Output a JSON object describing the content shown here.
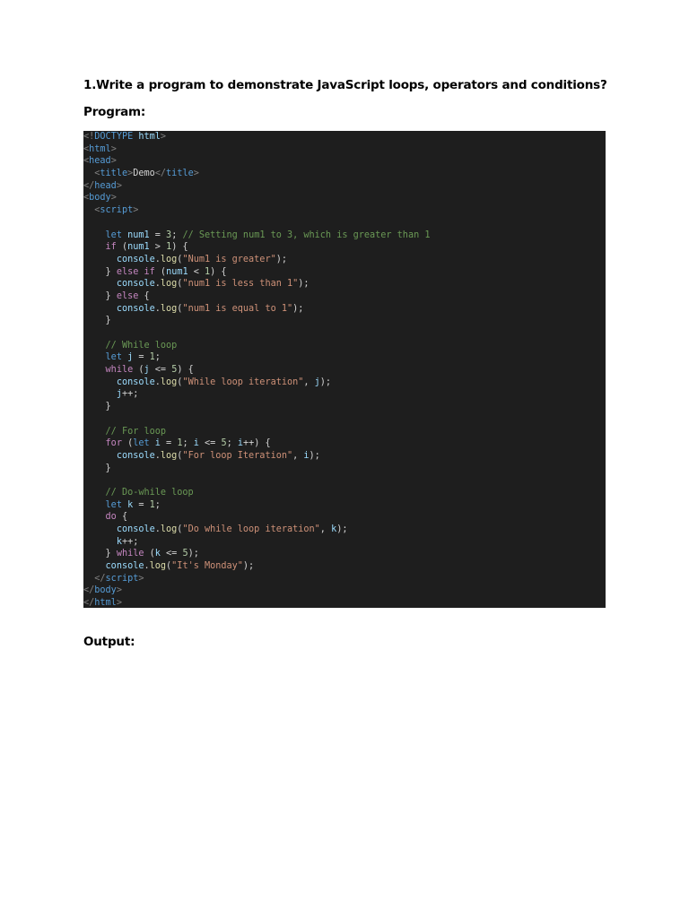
{
  "document": {
    "question": "1.Write a program to demonstrate JavaScript loops, operators and conditions?",
    "program_label": "Program:",
    "output_label": "Output:"
  },
  "code_block": {
    "background_color": "#1e1e1e",
    "lines": [
      [
        {
          "t": "<!",
          "c": "punct"
        },
        {
          "t": "DOCTYPE",
          "c": "tag"
        },
        {
          "t": " ",
          "c": "plain"
        },
        {
          "t": "html",
          "c": "var"
        },
        {
          "t": ">",
          "c": "punct"
        }
      ],
      [
        {
          "t": "<",
          "c": "punct"
        },
        {
          "t": "html",
          "c": "tag"
        },
        {
          "t": ">",
          "c": "punct"
        }
      ],
      [
        {
          "t": "<",
          "c": "punct"
        },
        {
          "t": "head",
          "c": "tag"
        },
        {
          "t": ">",
          "c": "punct"
        }
      ],
      [
        {
          "t": "  <",
          "c": "punct"
        },
        {
          "t": "title",
          "c": "tag"
        },
        {
          "t": ">",
          "c": "punct"
        },
        {
          "t": "Demo",
          "c": "plain"
        },
        {
          "t": "</",
          "c": "punct"
        },
        {
          "t": "title",
          "c": "tag"
        },
        {
          "t": ">",
          "c": "punct"
        }
      ],
      [
        {
          "t": "</",
          "c": "punct"
        },
        {
          "t": "head",
          "c": "tag"
        },
        {
          "t": ">",
          "c": "punct"
        }
      ],
      [
        {
          "t": "<",
          "c": "punct"
        },
        {
          "t": "body",
          "c": "tag"
        },
        {
          "t": ">",
          "c": "punct"
        }
      ],
      [
        {
          "t": "  <",
          "c": "punct"
        },
        {
          "t": "script",
          "c": "tag"
        },
        {
          "t": ">",
          "c": "punct"
        }
      ],
      [],
      [
        {
          "t": "    ",
          "c": "plain"
        },
        {
          "t": "let",
          "c": "kw"
        },
        {
          "t": " ",
          "c": "plain"
        },
        {
          "t": "num1",
          "c": "var"
        },
        {
          "t": " = ",
          "c": "plain"
        },
        {
          "t": "3",
          "c": "num"
        },
        {
          "t": "; ",
          "c": "plain"
        },
        {
          "t": "// Setting num1 to 3, which is greater than 1",
          "c": "cmt"
        }
      ],
      [
        {
          "t": "    ",
          "c": "plain"
        },
        {
          "t": "if",
          "c": "ctrl"
        },
        {
          "t": " (",
          "c": "plain"
        },
        {
          "t": "num1",
          "c": "var"
        },
        {
          "t": " > ",
          "c": "plain"
        },
        {
          "t": "1",
          "c": "num"
        },
        {
          "t": ") {",
          "c": "plain"
        }
      ],
      [
        {
          "t": "      ",
          "c": "plain"
        },
        {
          "t": "console",
          "c": "var"
        },
        {
          "t": ".",
          "c": "plain"
        },
        {
          "t": "log",
          "c": "fn"
        },
        {
          "t": "(",
          "c": "plain"
        },
        {
          "t": "\"Num1 is greater\"",
          "c": "str"
        },
        {
          "t": ");",
          "c": "plain"
        }
      ],
      [
        {
          "t": "    } ",
          "c": "plain"
        },
        {
          "t": "else",
          "c": "ctrl"
        },
        {
          "t": " ",
          "c": "plain"
        },
        {
          "t": "if",
          "c": "ctrl"
        },
        {
          "t": " (",
          "c": "plain"
        },
        {
          "t": "num1",
          "c": "var"
        },
        {
          "t": " < ",
          "c": "plain"
        },
        {
          "t": "1",
          "c": "num"
        },
        {
          "t": ") {",
          "c": "plain"
        }
      ],
      [
        {
          "t": "      ",
          "c": "plain"
        },
        {
          "t": "console",
          "c": "var"
        },
        {
          "t": ".",
          "c": "plain"
        },
        {
          "t": "log",
          "c": "fn"
        },
        {
          "t": "(",
          "c": "plain"
        },
        {
          "t": "\"num1 is less than 1\"",
          "c": "str"
        },
        {
          "t": ");",
          "c": "plain"
        }
      ],
      [
        {
          "t": "    } ",
          "c": "plain"
        },
        {
          "t": "else",
          "c": "ctrl"
        },
        {
          "t": " {",
          "c": "plain"
        }
      ],
      [
        {
          "t": "      ",
          "c": "plain"
        },
        {
          "t": "console",
          "c": "var"
        },
        {
          "t": ".",
          "c": "plain"
        },
        {
          "t": "log",
          "c": "fn"
        },
        {
          "t": "(",
          "c": "plain"
        },
        {
          "t": "\"num1 is equal to 1\"",
          "c": "str"
        },
        {
          "t": ");",
          "c": "plain"
        }
      ],
      [
        {
          "t": "    }",
          "c": "plain"
        }
      ],
      [],
      [
        {
          "t": "    ",
          "c": "plain"
        },
        {
          "t": "// While loop",
          "c": "cmt"
        }
      ],
      [
        {
          "t": "    ",
          "c": "plain"
        },
        {
          "t": "let",
          "c": "kw"
        },
        {
          "t": " ",
          "c": "plain"
        },
        {
          "t": "j",
          "c": "var"
        },
        {
          "t": " = ",
          "c": "plain"
        },
        {
          "t": "1",
          "c": "num"
        },
        {
          "t": ";",
          "c": "plain"
        }
      ],
      [
        {
          "t": "    ",
          "c": "plain"
        },
        {
          "t": "while",
          "c": "ctrl"
        },
        {
          "t": " (",
          "c": "plain"
        },
        {
          "t": "j",
          "c": "var"
        },
        {
          "t": " <= ",
          "c": "plain"
        },
        {
          "t": "5",
          "c": "num"
        },
        {
          "t": ") {",
          "c": "plain"
        }
      ],
      [
        {
          "t": "      ",
          "c": "plain"
        },
        {
          "t": "console",
          "c": "var"
        },
        {
          "t": ".",
          "c": "plain"
        },
        {
          "t": "log",
          "c": "fn"
        },
        {
          "t": "(",
          "c": "plain"
        },
        {
          "t": "\"While loop iteration\"",
          "c": "str"
        },
        {
          "t": ", ",
          "c": "plain"
        },
        {
          "t": "j",
          "c": "var"
        },
        {
          "t": ");",
          "c": "plain"
        }
      ],
      [
        {
          "t": "      ",
          "c": "plain"
        },
        {
          "t": "j",
          "c": "var"
        },
        {
          "t": "++;",
          "c": "plain"
        }
      ],
      [
        {
          "t": "    }",
          "c": "plain"
        }
      ],
      [],
      [
        {
          "t": "    ",
          "c": "plain"
        },
        {
          "t": "// For loop",
          "c": "cmt"
        }
      ],
      [
        {
          "t": "    ",
          "c": "plain"
        },
        {
          "t": "for",
          "c": "ctrl"
        },
        {
          "t": " (",
          "c": "plain"
        },
        {
          "t": "let",
          "c": "kw"
        },
        {
          "t": " ",
          "c": "plain"
        },
        {
          "t": "i",
          "c": "var"
        },
        {
          "t": " = ",
          "c": "plain"
        },
        {
          "t": "1",
          "c": "num"
        },
        {
          "t": "; ",
          "c": "plain"
        },
        {
          "t": "i",
          "c": "var"
        },
        {
          "t": " <= ",
          "c": "plain"
        },
        {
          "t": "5",
          "c": "num"
        },
        {
          "t": "; ",
          "c": "plain"
        },
        {
          "t": "i",
          "c": "var"
        },
        {
          "t": "++) {",
          "c": "plain"
        }
      ],
      [
        {
          "t": "      ",
          "c": "plain"
        },
        {
          "t": "console",
          "c": "var"
        },
        {
          "t": ".",
          "c": "plain"
        },
        {
          "t": "log",
          "c": "fn"
        },
        {
          "t": "(",
          "c": "plain"
        },
        {
          "t": "\"For loop Iteration\"",
          "c": "str"
        },
        {
          "t": ", ",
          "c": "plain"
        },
        {
          "t": "i",
          "c": "var"
        },
        {
          "t": ");",
          "c": "plain"
        }
      ],
      [
        {
          "t": "    }",
          "c": "plain"
        }
      ],
      [],
      [
        {
          "t": "    ",
          "c": "plain"
        },
        {
          "t": "// Do-while loop",
          "c": "cmt"
        }
      ],
      [
        {
          "t": "    ",
          "c": "plain"
        },
        {
          "t": "let",
          "c": "kw"
        },
        {
          "t": " ",
          "c": "plain"
        },
        {
          "t": "k",
          "c": "var"
        },
        {
          "t": " = ",
          "c": "plain"
        },
        {
          "t": "1",
          "c": "num"
        },
        {
          "t": ";",
          "c": "plain"
        }
      ],
      [
        {
          "t": "    ",
          "c": "plain"
        },
        {
          "t": "do",
          "c": "ctrl"
        },
        {
          "t": " {",
          "c": "plain"
        }
      ],
      [
        {
          "t": "      ",
          "c": "plain"
        },
        {
          "t": "console",
          "c": "var"
        },
        {
          "t": ".",
          "c": "plain"
        },
        {
          "t": "log",
          "c": "fn"
        },
        {
          "t": "(",
          "c": "plain"
        },
        {
          "t": "\"Do while loop iteration\"",
          "c": "str"
        },
        {
          "t": ", ",
          "c": "plain"
        },
        {
          "t": "k",
          "c": "var"
        },
        {
          "t": ");",
          "c": "plain"
        }
      ],
      [
        {
          "t": "      ",
          "c": "plain"
        },
        {
          "t": "k",
          "c": "var"
        },
        {
          "t": "++;",
          "c": "plain"
        }
      ],
      [
        {
          "t": "    } ",
          "c": "plain"
        },
        {
          "t": "while",
          "c": "ctrl"
        },
        {
          "t": " (",
          "c": "plain"
        },
        {
          "t": "k",
          "c": "var"
        },
        {
          "t": " <= ",
          "c": "plain"
        },
        {
          "t": "5",
          "c": "num"
        },
        {
          "t": ");",
          "c": "plain"
        }
      ],
      [
        {
          "t": "    ",
          "c": "plain"
        },
        {
          "t": "console",
          "c": "var"
        },
        {
          "t": ".",
          "c": "plain"
        },
        {
          "t": "log",
          "c": "fn"
        },
        {
          "t": "(",
          "c": "plain"
        },
        {
          "t": "\"It's Monday\"",
          "c": "str"
        },
        {
          "t": ");",
          "c": "plain"
        }
      ],
      [
        {
          "t": "  </",
          "c": "punct"
        },
        {
          "t": "script",
          "c": "tag"
        },
        {
          "t": ">",
          "c": "punct"
        }
      ],
      [
        {
          "t": "</",
          "c": "punct"
        },
        {
          "t": "body",
          "c": "tag"
        },
        {
          "t": ">",
          "c": "punct"
        }
      ],
      [
        {
          "t": "</",
          "c": "punct"
        },
        {
          "t": "html",
          "c": "tag"
        },
        {
          "t": ">",
          "c": "punct"
        }
      ]
    ]
  }
}
